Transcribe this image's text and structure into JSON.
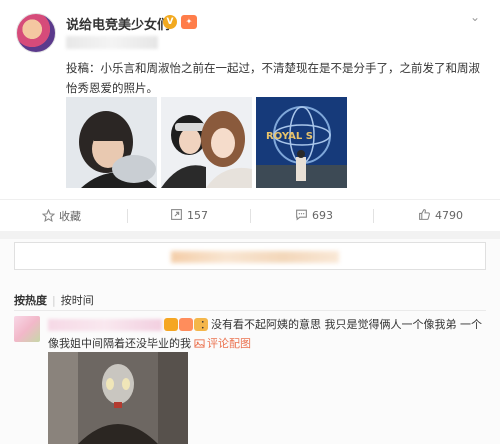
{
  "post": {
    "author": "说给电竞美少女们",
    "verified_badge": "V",
    "text": "投稿：小乐言和周淑怡之前在一起过，不清楚现在是不是分手了，之前发了和周淑怡秀恩爱的照片。",
    "images": [
      {
        "icon": "photo-portrait"
      },
      {
        "icon": "photo-selfie"
      },
      {
        "icon": "photo-universal-globe",
        "sign_text": "ROYAL S"
      }
    ]
  },
  "actions": {
    "favorite_label": "收藏",
    "repost_count": "157",
    "comment_count": "693",
    "like_count": "4790"
  },
  "comments": {
    "sort_hot": "按热度",
    "sort_time": "按时间",
    "items": [
      {
        "text": "：没有看不起阿姨的意思 我只是觉得俩人一个像我弟 一个像我姐中间隔着还没毕业的我",
        "pic_link": "评论配图"
      }
    ]
  },
  "colors": {
    "accent": "#eb7350",
    "verified": "#f2a91f"
  }
}
